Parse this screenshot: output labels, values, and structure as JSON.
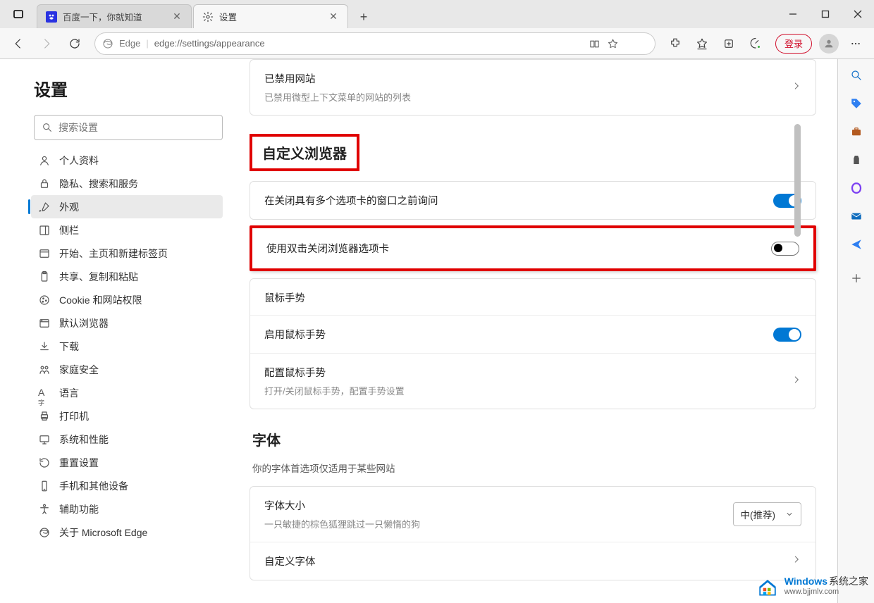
{
  "tabs": {
    "tab1_title": "百度一下，你就知道",
    "tab2_title": "设置"
  },
  "toolbar": {
    "site_name": "Edge",
    "url": "edge://settings/appearance",
    "login_label": "登录"
  },
  "sidebar": {
    "title": "设置",
    "search_placeholder": "搜索设置",
    "items": [
      {
        "label": "个人资料"
      },
      {
        "label": "隐私、搜索和服务"
      },
      {
        "label": "外观"
      },
      {
        "label": "侧栏"
      },
      {
        "label": "开始、主页和新建标签页"
      },
      {
        "label": "共享、复制和粘贴"
      },
      {
        "label": "Cookie 和网站权限"
      },
      {
        "label": "默认浏览器"
      },
      {
        "label": "下载"
      },
      {
        "label": "家庭安全"
      },
      {
        "label": "语言"
      },
      {
        "label": "打印机"
      },
      {
        "label": "系统和性能"
      },
      {
        "label": "重置设置"
      },
      {
        "label": "手机和其他设备"
      },
      {
        "label": "辅助功能"
      },
      {
        "label": "关于 Microsoft Edge"
      }
    ]
  },
  "content": {
    "blocked": {
      "title": "已禁用网站",
      "sub": "已禁用微型上下文菜单的网站的列表"
    },
    "section_custom": {
      "header": "自定义浏览器"
    },
    "ask_close": {
      "title": "在关闭具有多个选项卡的窗口之前询问",
      "on": true
    },
    "dblclick_close": {
      "title": "使用双击关闭浏览器选项卡",
      "on": false
    },
    "mouse_gesture_header": "鼠标手势",
    "enable_gesture": {
      "title": "启用鼠标手势",
      "on": true
    },
    "config_gesture": {
      "title": "配置鼠标手势",
      "sub": "打开/关闭鼠标手势，配置手势设置"
    },
    "font_section": {
      "header": "字体",
      "sub": "你的字体首选项仅适用于某些网站"
    },
    "font_size": {
      "title": "字体大小",
      "sample": "一只敏捷的棕色狐狸跳过一只懒惰的狗",
      "value": "中(推荐)"
    },
    "custom_font": {
      "title": "自定义字体"
    }
  },
  "watermark": {
    "line1_a": "Windows",
    "line1_b": "系统之家",
    "line2": "www.bjjmlv.com"
  }
}
